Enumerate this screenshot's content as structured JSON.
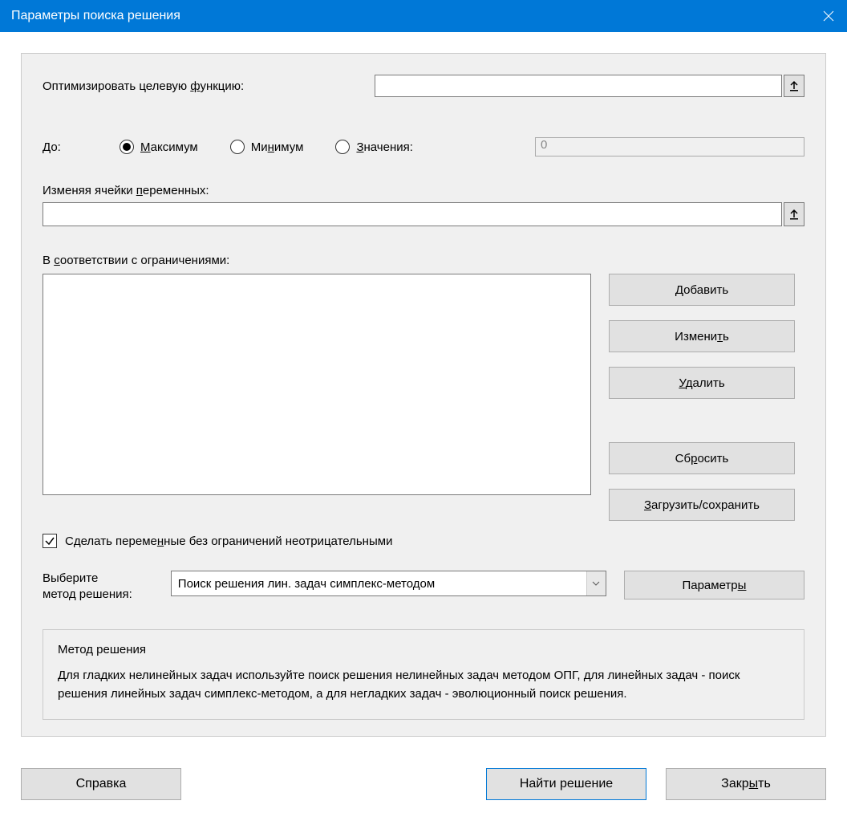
{
  "title": "Параметры поиска решения",
  "optimize": {
    "label_before": "Оптимизировать целевую ",
    "label_underlined": "ф",
    "label_after": "ункцию:",
    "value": ""
  },
  "to": {
    "label": "До:",
    "options": {
      "max_before": "",
      "max_underlined": "М",
      "max_after": "аксимум",
      "min_before": "Ми",
      "min_underlined": "н",
      "min_after": "имум",
      "val_before": "",
      "val_underlined": "З",
      "val_after": "начения:"
    },
    "selected": "max",
    "value_input": "0"
  },
  "changing": {
    "label_before": "Изменяя ячейки ",
    "label_underlined": "п",
    "label_after": "еременных:",
    "value": ""
  },
  "constraints": {
    "label_before": "В ",
    "label_underlined": "с",
    "label_after": "оответствии с ограничениями:",
    "buttons": {
      "add_before": "",
      "add_underlined": "Д",
      "add_after": "обавить",
      "change_before": "Измени",
      "change_underlined": "т",
      "change_after": "ь",
      "delete_before": "",
      "delete_underlined": "У",
      "delete_after": "далить",
      "reset_before": "Сб",
      "reset_underlined": "р",
      "reset_after": "осить",
      "loadsave_before": "",
      "loadsave_underlined": "З",
      "loadsave_after": "агрузить/сохранить"
    }
  },
  "nonneg": {
    "checked": true,
    "label_before": "Сделать переме",
    "label_underlined": "н",
    "label_after": "ные без ограничений неотрицательными"
  },
  "method": {
    "label": "Выберите\nметод решения:",
    "label_line1": "Выберите",
    "label_line2": "метод решения:",
    "selected": "Поиск решения лин. задач симплекс-методом",
    "params_btn_before": "Параметр",
    "params_btn_underlined": "ы",
    "params_btn_after": ""
  },
  "groupbox": {
    "title": "Метод решения",
    "desc": "Для гладких нелинейных задач используйте поиск решения нелинейных задач методом ОПГ, для линейных задач - поиск решения линейных задач симплекс-методом, а для негладких задач - эволюционный поиск решения."
  },
  "bottom": {
    "help": "Справка",
    "solve": "Найти решение",
    "close_before": "Закр",
    "close_underlined": "ы",
    "close_after": "ть"
  }
}
